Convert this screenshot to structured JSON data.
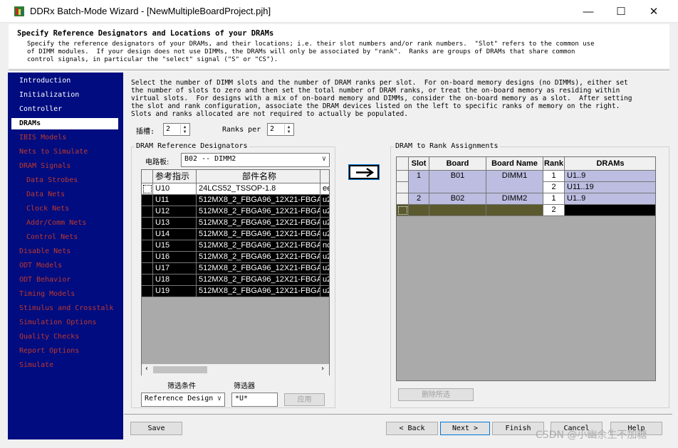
{
  "window": {
    "title": "DDRx Batch-Mode Wizard - [NewMultipleBoardProject.pjh]",
    "minimize": "—",
    "maximize": "☐",
    "close": "✕"
  },
  "header": {
    "title": "Specify Reference Designators and Locations of your DRAMs",
    "description": "Specify the reference designators of your DRAMs, and their locations; i.e. their slot numbers and/or rank numbers.  \"Slot\" refers to the common use\nof DIMM modules.  If your design does not use DIMMs, the DRAMs will only be associated by \"rank\".  Ranks are groups of DRAMs that share common\ncontrol signals, in particular the \"select\" signal (\"S\" or \"CS\")."
  },
  "nav": {
    "items": [
      {
        "label": "Introduction",
        "state": "done"
      },
      {
        "label": "Initialization",
        "state": "done"
      },
      {
        "label": "Controller",
        "state": "done"
      },
      {
        "label": "DRAMs",
        "state": "selected"
      },
      {
        "label": "IBIS Models",
        "state": "pending"
      },
      {
        "label": "Nets to Simulate",
        "state": "pending"
      },
      {
        "label": "DRAM Signals",
        "state": "pending"
      },
      {
        "label": "Data Strobes",
        "state": "pending"
      },
      {
        "label": "Data Nets",
        "state": "pending"
      },
      {
        "label": "Clock Nets",
        "state": "pending"
      },
      {
        "label": "Addr/Comm Nets",
        "state": "pending"
      },
      {
        "label": "Control Nets",
        "state": "pending"
      },
      {
        "label": "Disable Nets",
        "state": "pending"
      },
      {
        "label": "ODT Models",
        "state": "pending"
      },
      {
        "label": "ODT Behavior",
        "state": "pending"
      },
      {
        "label": "Timing Models",
        "state": "pending"
      },
      {
        "label": "Stimulus and Crosstalk",
        "state": "pending"
      },
      {
        "label": "Simulation Options",
        "state": "pending"
      },
      {
        "label": "Quality Checks",
        "state": "pending"
      },
      {
        "label": "Report Options",
        "state": "pending"
      },
      {
        "label": "Simulate",
        "state": "pending"
      }
    ]
  },
  "instructions": "Select the number of DIMM slots and the number of DRAM ranks per slot.  For on-board memory designs (no DIMMs), either set\nthe number of slots to zero and then set the total number of DRAM ranks, or treat the on-board memory as residing within\nvirtual slots.  For designs with a mix of on-board memory and DIMMs, consider the on-board memory as a slot.  After setting\nthe slot and rank configuration, associate the DRAM devices listed on the left to specific ranks of memory on the right.\nSlots and ranks allocated are not required to actually be populated.",
  "slots": {
    "label": "插槽:",
    "value": "2"
  },
  "ranks": {
    "label": "Ranks per",
    "value": "2"
  },
  "ref_group": {
    "title": "DRAM Reference Designators",
    "board_label": "电路板:",
    "board_value": "B02 -- DIMM2",
    "columns": [
      "参考指示",
      "部件名称",
      ""
    ],
    "rows": [
      {
        "ref": "U10",
        "part": "24LCS52_TSSOP-1.8",
        "extra": "ee"
      },
      {
        "ref": "U11",
        "part": "512MX8_2_FBGA96_12X21-FBGA9",
        "extra": "u2"
      },
      {
        "ref": "U12",
        "part": "512MX8_2_FBGA96_12X21-FBGA9",
        "extra": "u2"
      },
      {
        "ref": "U13",
        "part": "512MX8_2_FBGA96_12X21-FBGA9",
        "extra": "u2"
      },
      {
        "ref": "U14",
        "part": "512MX8_2_FBGA96_12X21-FBGA9",
        "extra": "u2"
      },
      {
        "ref": "U15",
        "part": "512MX8_2_FBGA96_12X21-FBGA9",
        "extra": "nc"
      },
      {
        "ref": "U16",
        "part": "512MX8_2_FBGA96_12X21-FBGA9",
        "extra": "u2"
      },
      {
        "ref": "U17",
        "part": "512MX8_2_FBGA96_12X21-FBGA9",
        "extra": "u2"
      },
      {
        "ref": "U18",
        "part": "512MX8_2_FBGA96_12X21-FBGA9",
        "extra": "u2"
      },
      {
        "ref": "U19",
        "part": "512MX8_2_FBGA96_12X21-FBGA9",
        "extra": "u2"
      }
    ],
    "filter_condition_label": "筛选条件",
    "filter_label": "筛选器",
    "filter_select": "Reference Design",
    "filter_value": "*U*",
    "apply": "应用"
  },
  "assign_arrow": "→",
  "rank_group": {
    "title": "DRAM to Rank Assignments",
    "columns": [
      "Slot",
      "Board",
      "Board Name",
      "Rank",
      "DRAMs"
    ],
    "rows": [
      {
        "slot": "1",
        "board": "B01",
        "board_name": "DIMM1",
        "rank": "1",
        "drams": "U1..9"
      },
      {
        "slot": "",
        "board": "",
        "board_name": "",
        "rank": "2",
        "drams": "U11..19"
      },
      {
        "slot": "2",
        "board": "B02",
        "board_name": "DIMM2",
        "rank": "1",
        "drams": "U1..9"
      },
      {
        "slot": "",
        "board": "",
        "board_name": "",
        "rank": "2",
        "drams": ""
      }
    ],
    "delete_selected": "删除所选"
  },
  "buttons": {
    "save": "Save",
    "back": "< Back",
    "next": "Next >",
    "finish": "Finish",
    "cancel": "Cancel",
    "help": "Help"
  },
  "watermark": "CSDN @小幽余生不加糖",
  "colors": {
    "nav_bg": "#000c80",
    "nav_pending": "#c0392b",
    "grid_selected": "#000000",
    "rank_slot_fill": "#bcbde0",
    "rank_cur_fill": "#5a5a2e"
  }
}
